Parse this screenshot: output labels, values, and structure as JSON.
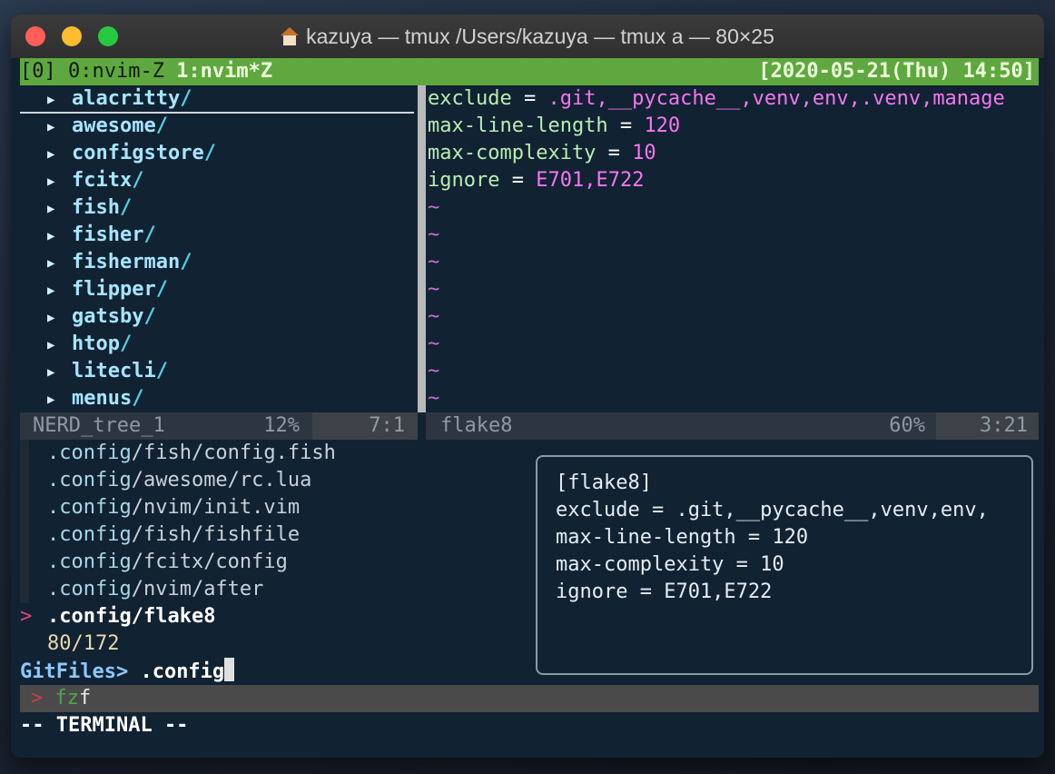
{
  "window": {
    "title": "kazuya — tmux  /Users/kazuya — tmux a — 80×25",
    "title_icon": "home-icon"
  },
  "tmux": {
    "session_label": "[0] 0:nvim-Z ",
    "current_window": "1:nvim*Z",
    "datetime": "[2020-05-21(Thu) 14:50]",
    "bar_color": "#5fa83f"
  },
  "nerdtree": {
    "entries": [
      "alacritty",
      "awesome",
      "configstore",
      "fcitx",
      "fish",
      "fisher",
      "fisherman",
      "flipper",
      "gatsby",
      "htop",
      "litecli",
      "menus"
    ],
    "slash": "/",
    "arrow_icon": "triangle-right-icon",
    "status": {
      "name": "NERD_tree_1",
      "percent": "12%",
      "position": "7:1"
    }
  },
  "editor": {
    "lines": [
      {
        "key": "exclude",
        "op": " = ",
        "val": ".git,__pycache__,venv,env,.venv,manage"
      },
      {
        "key": "max-line-length",
        "op": " = ",
        "val": "120"
      },
      {
        "key": "max-complexity",
        "op": " = ",
        "val": "10"
      },
      {
        "key": "ignore",
        "op": " = ",
        "val": "E701,E722"
      }
    ],
    "tilde": "~",
    "status": {
      "name": "flake8",
      "percent": "60%",
      "position": "3:21"
    }
  },
  "fzf": {
    "results": [
      {
        "dir": ".config",
        "rest": "/fish/config.fish"
      },
      {
        "dir": ".config",
        "rest": "/awesome/rc.lua"
      },
      {
        "dir": ".config",
        "rest": "/nvim/init.vim"
      },
      {
        "dir": ".config",
        "rest": "/fish/fishfile"
      },
      {
        "dir": ".config",
        "rest": "/fcitx/config"
      },
      {
        "dir": ".config",
        "rest": "/nvim/after"
      }
    ],
    "selected": {
      "pointer": ">",
      "dir": ".config",
      "rest": "/flake8"
    },
    "count": "80/172",
    "prompt": "GitFiles> ",
    "query": ".config",
    "preview": [
      "[flake8]",
      "exclude = .git,__pycache__,venv,env,",
      "max-line-length = 120",
      "max-complexity = 10",
      "ignore = E701,E722"
    ]
  },
  "cmdline": {
    "prompt": ">",
    "typed_fz": "fz",
    "typed_f": "f"
  },
  "mode": "-- TERMINAL --"
}
